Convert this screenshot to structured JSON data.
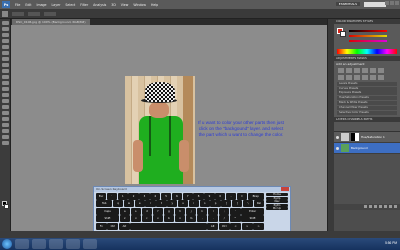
{
  "app": {
    "logo": "Ps",
    "menu": [
      "File",
      "Edit",
      "Image",
      "Layer",
      "Select",
      "Filter",
      "Analysis",
      "3D",
      "View",
      "Window",
      "Help"
    ],
    "workspace": "ESSENTIALS"
  },
  "document": {
    "tab_title": "DSC_0106.jpg @ 100% (Background, RGB/8#)"
  },
  "canvas": {
    "instruction": "If u want to color your other parts then just click on the \"backgound\" layer. and select the part which u want to change the color."
  },
  "keyboard": {
    "title": "On-Screen Keyboard",
    "rows": [
      [
        "Esc",
        "`",
        "1",
        "2",
        "3",
        "4",
        "5",
        "6",
        "7",
        "8",
        "9",
        "0",
        "-",
        "=",
        "Bksp"
      ],
      [
        "Tab",
        "q",
        "w",
        "e",
        "r",
        "t",
        "y",
        "u",
        "i",
        "o",
        "p",
        "[",
        "]",
        "\\",
        "Del"
      ],
      [
        "Caps",
        "a",
        "s",
        "d",
        "f",
        "g",
        "h",
        "j",
        "k",
        "l",
        ";",
        "'",
        "Enter"
      ],
      [
        "Shift",
        "z",
        "x",
        "c",
        "v",
        "b",
        "n",
        "m",
        ",",
        ".",
        "/",
        "^",
        "Shift"
      ],
      [
        "Fn",
        "Ctrl",
        "Alt",
        "",
        "Alt",
        "Ctrl",
        "<",
        "v",
        ">"
      ]
    ],
    "right_keys": [
      "Home",
      "PgUp",
      "Nav",
      "PgDn",
      "Mv Up"
    ]
  },
  "panels": {
    "color_tabs": [
      "COLOR",
      "SWATCHES",
      "STYLES"
    ],
    "adjust_tabs": [
      "ADJUSTMENTS",
      "MASKS"
    ],
    "adjust_title": "Add an adjustment",
    "presets": [
      "Levels Presets",
      "Curves Presets",
      "Exposure Presets",
      "Hue/Saturation Presets",
      "Black & White Presets",
      "Channel Mixer Presets",
      "Selective Color Presets"
    ],
    "layers_tabs": [
      "LAYERS",
      "CHANNELS",
      "PATHS"
    ],
    "layers": [
      {
        "name": "Hue/Saturation 1",
        "selected": false
      },
      {
        "name": "Background",
        "selected": true
      }
    ]
  },
  "taskbar": {
    "clock": "5:56 PM"
  }
}
